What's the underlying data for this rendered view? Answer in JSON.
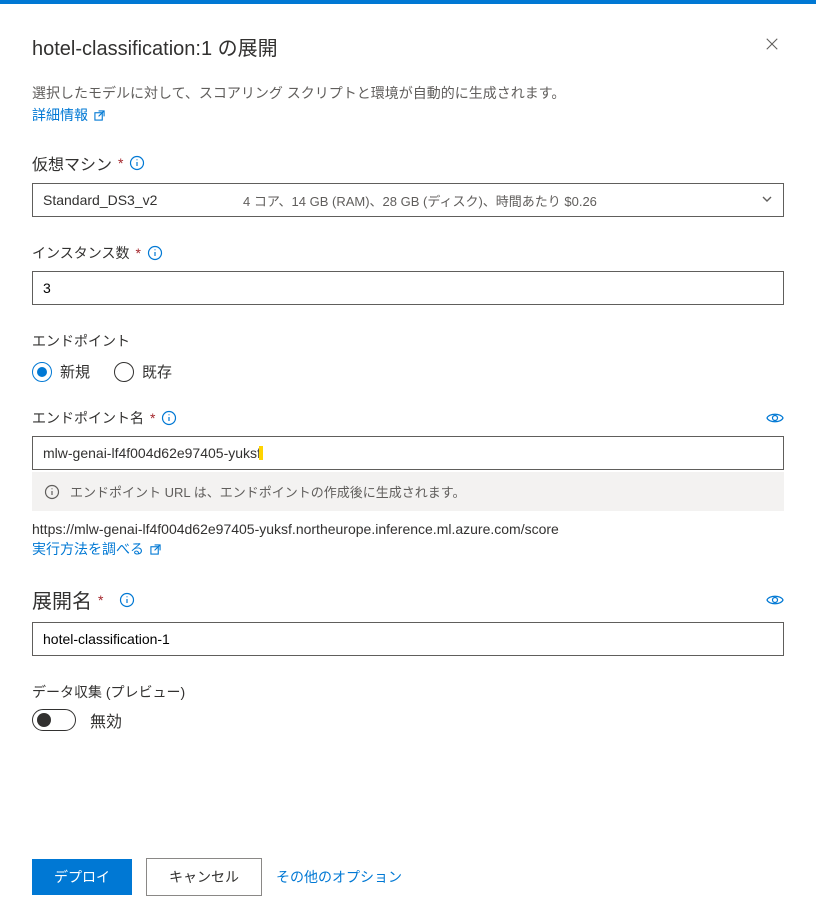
{
  "header": {
    "title": "hotel-classification:1 の展開"
  },
  "intro": {
    "description": "選択したモデルに対して、スコアリング スクリプトと環境が自動的に生成されます。",
    "details_link": "詳細情報"
  },
  "vm": {
    "label": "仮想マシン",
    "required": "*",
    "selected": "Standard_DS3_v2",
    "detail": "4 コア、14 GB (RAM)、28 GB (ディスク)、時間あたり $0.26"
  },
  "instances": {
    "label": "インスタンス数",
    "required": "*",
    "value": "3"
  },
  "endpoint": {
    "label": "エンドポイント",
    "option_new": "新規",
    "option_existing": "既存"
  },
  "endpoint_name": {
    "label": "エンドポイント名",
    "required": "*",
    "value": "mlw-genai-lf4f004d62e97405-yuksf",
    "banner": "エンドポイント URL は、エンドポイントの作成後に生成されます。",
    "url": "https://mlw-genai-lf4f004d62e97405-yuksf.northeurope.inference.ml.azure.com/score",
    "howto_link": "実行方法を調べる"
  },
  "deploy_name": {
    "label": "展開名",
    "required": "*",
    "value": "hotel-classification-1"
  },
  "data_collection": {
    "label": "データ収集 (プレビュー)",
    "state": "無効"
  },
  "footer": {
    "deploy": "デプロイ",
    "cancel": "キャンセル",
    "more": "その他のオプション"
  }
}
